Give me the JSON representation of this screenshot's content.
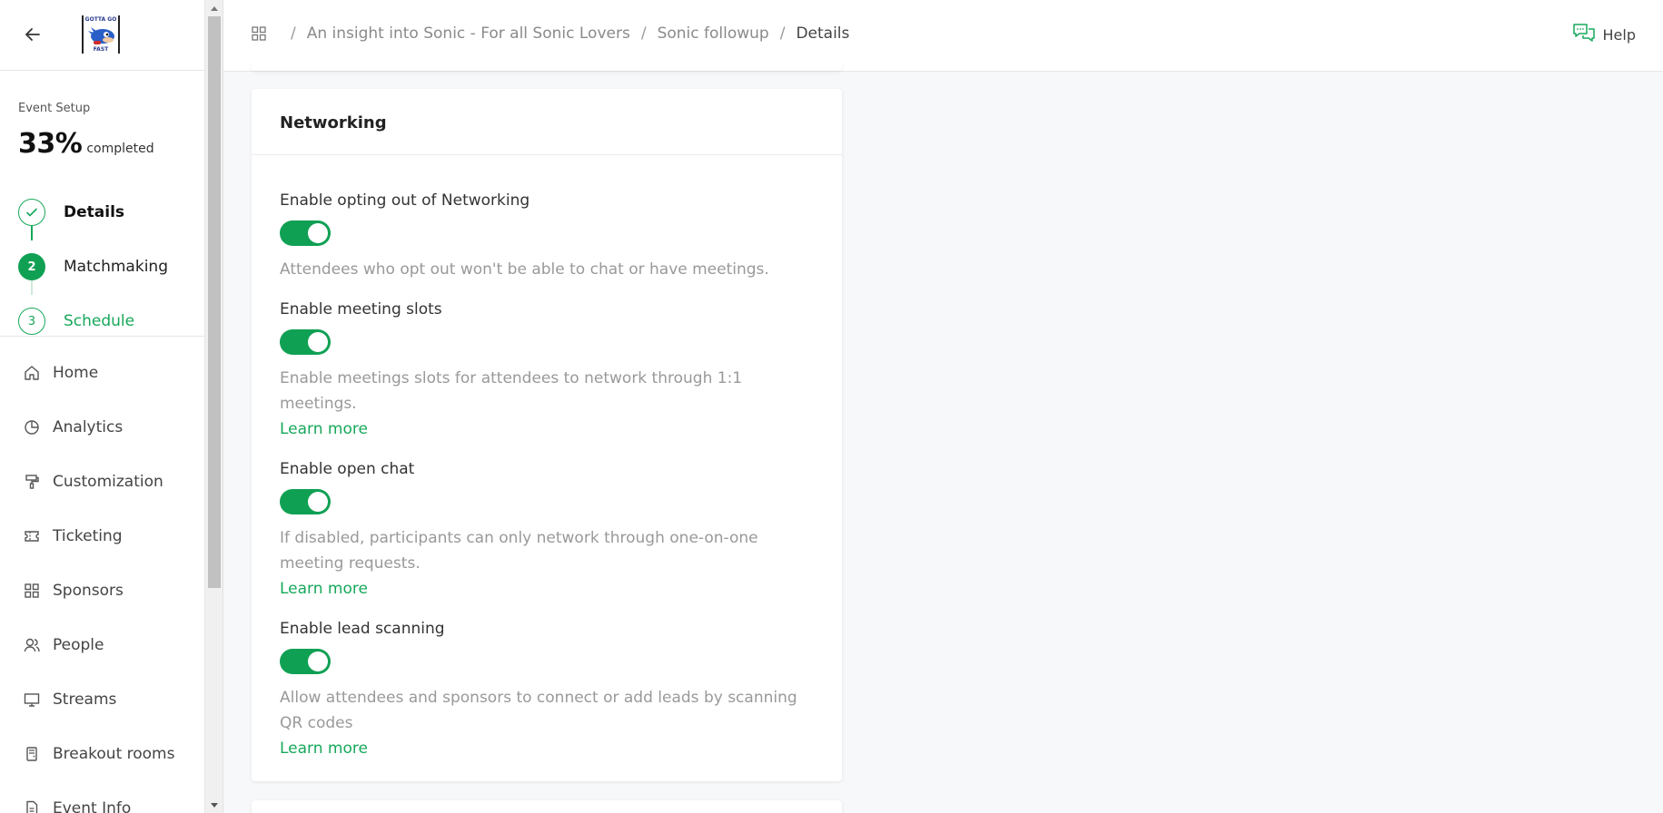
{
  "sidebar": {
    "logo_top": "GOTTA GO",
    "logo_bottom": "FAST",
    "setup_label": "Event Setup",
    "progress_percent": "33%",
    "progress_suffix": "completed",
    "steps": [
      {
        "number": "",
        "label": "Details",
        "state": "done"
      },
      {
        "number": "2",
        "label": "Matchmaking",
        "state": "active"
      },
      {
        "number": "3",
        "label": "Schedule",
        "state": "pending"
      }
    ],
    "nav": [
      {
        "label": "Home",
        "icon": "home-icon"
      },
      {
        "label": "Analytics",
        "icon": "pie-chart-icon"
      },
      {
        "label": "Customization",
        "icon": "paint-roller-icon"
      },
      {
        "label": "Ticketing",
        "icon": "ticket-icon"
      },
      {
        "label": "Sponsors",
        "icon": "grid-icon"
      },
      {
        "label": "People",
        "icon": "people-icon"
      },
      {
        "label": "Streams",
        "icon": "monitor-icon"
      },
      {
        "label": "Breakout rooms",
        "icon": "door-icon"
      },
      {
        "label": "Event Info",
        "icon": "document-icon"
      }
    ]
  },
  "header": {
    "breadcrumbs": [
      "An insight into Sonic - For all Sonic Lovers",
      "Sonic followup",
      "Details"
    ],
    "help_label": "Help"
  },
  "networking": {
    "title": "Networking",
    "settings": [
      {
        "label": "Enable opting out of Networking",
        "enabled": true,
        "description": "Attendees who opt out won't be able to chat or have meetings.",
        "learn_more": ""
      },
      {
        "label": "Enable meeting slots",
        "enabled": true,
        "description": "Enable meetings slots for attendees to network through 1:1 meetings.",
        "learn_more": "Learn more"
      },
      {
        "label": "Enable open chat",
        "enabled": true,
        "description": "If disabled, participants can only network through one-on-one meeting requests.",
        "learn_more": "Learn more"
      },
      {
        "label": "Enable lead scanning",
        "enabled": true,
        "description": "Allow attendees and sponsors to connect or add leads by scanning QR codes",
        "learn_more": "Learn more"
      }
    ]
  },
  "colors": {
    "accent": "#10a054",
    "accent_text": "#17a85a"
  }
}
